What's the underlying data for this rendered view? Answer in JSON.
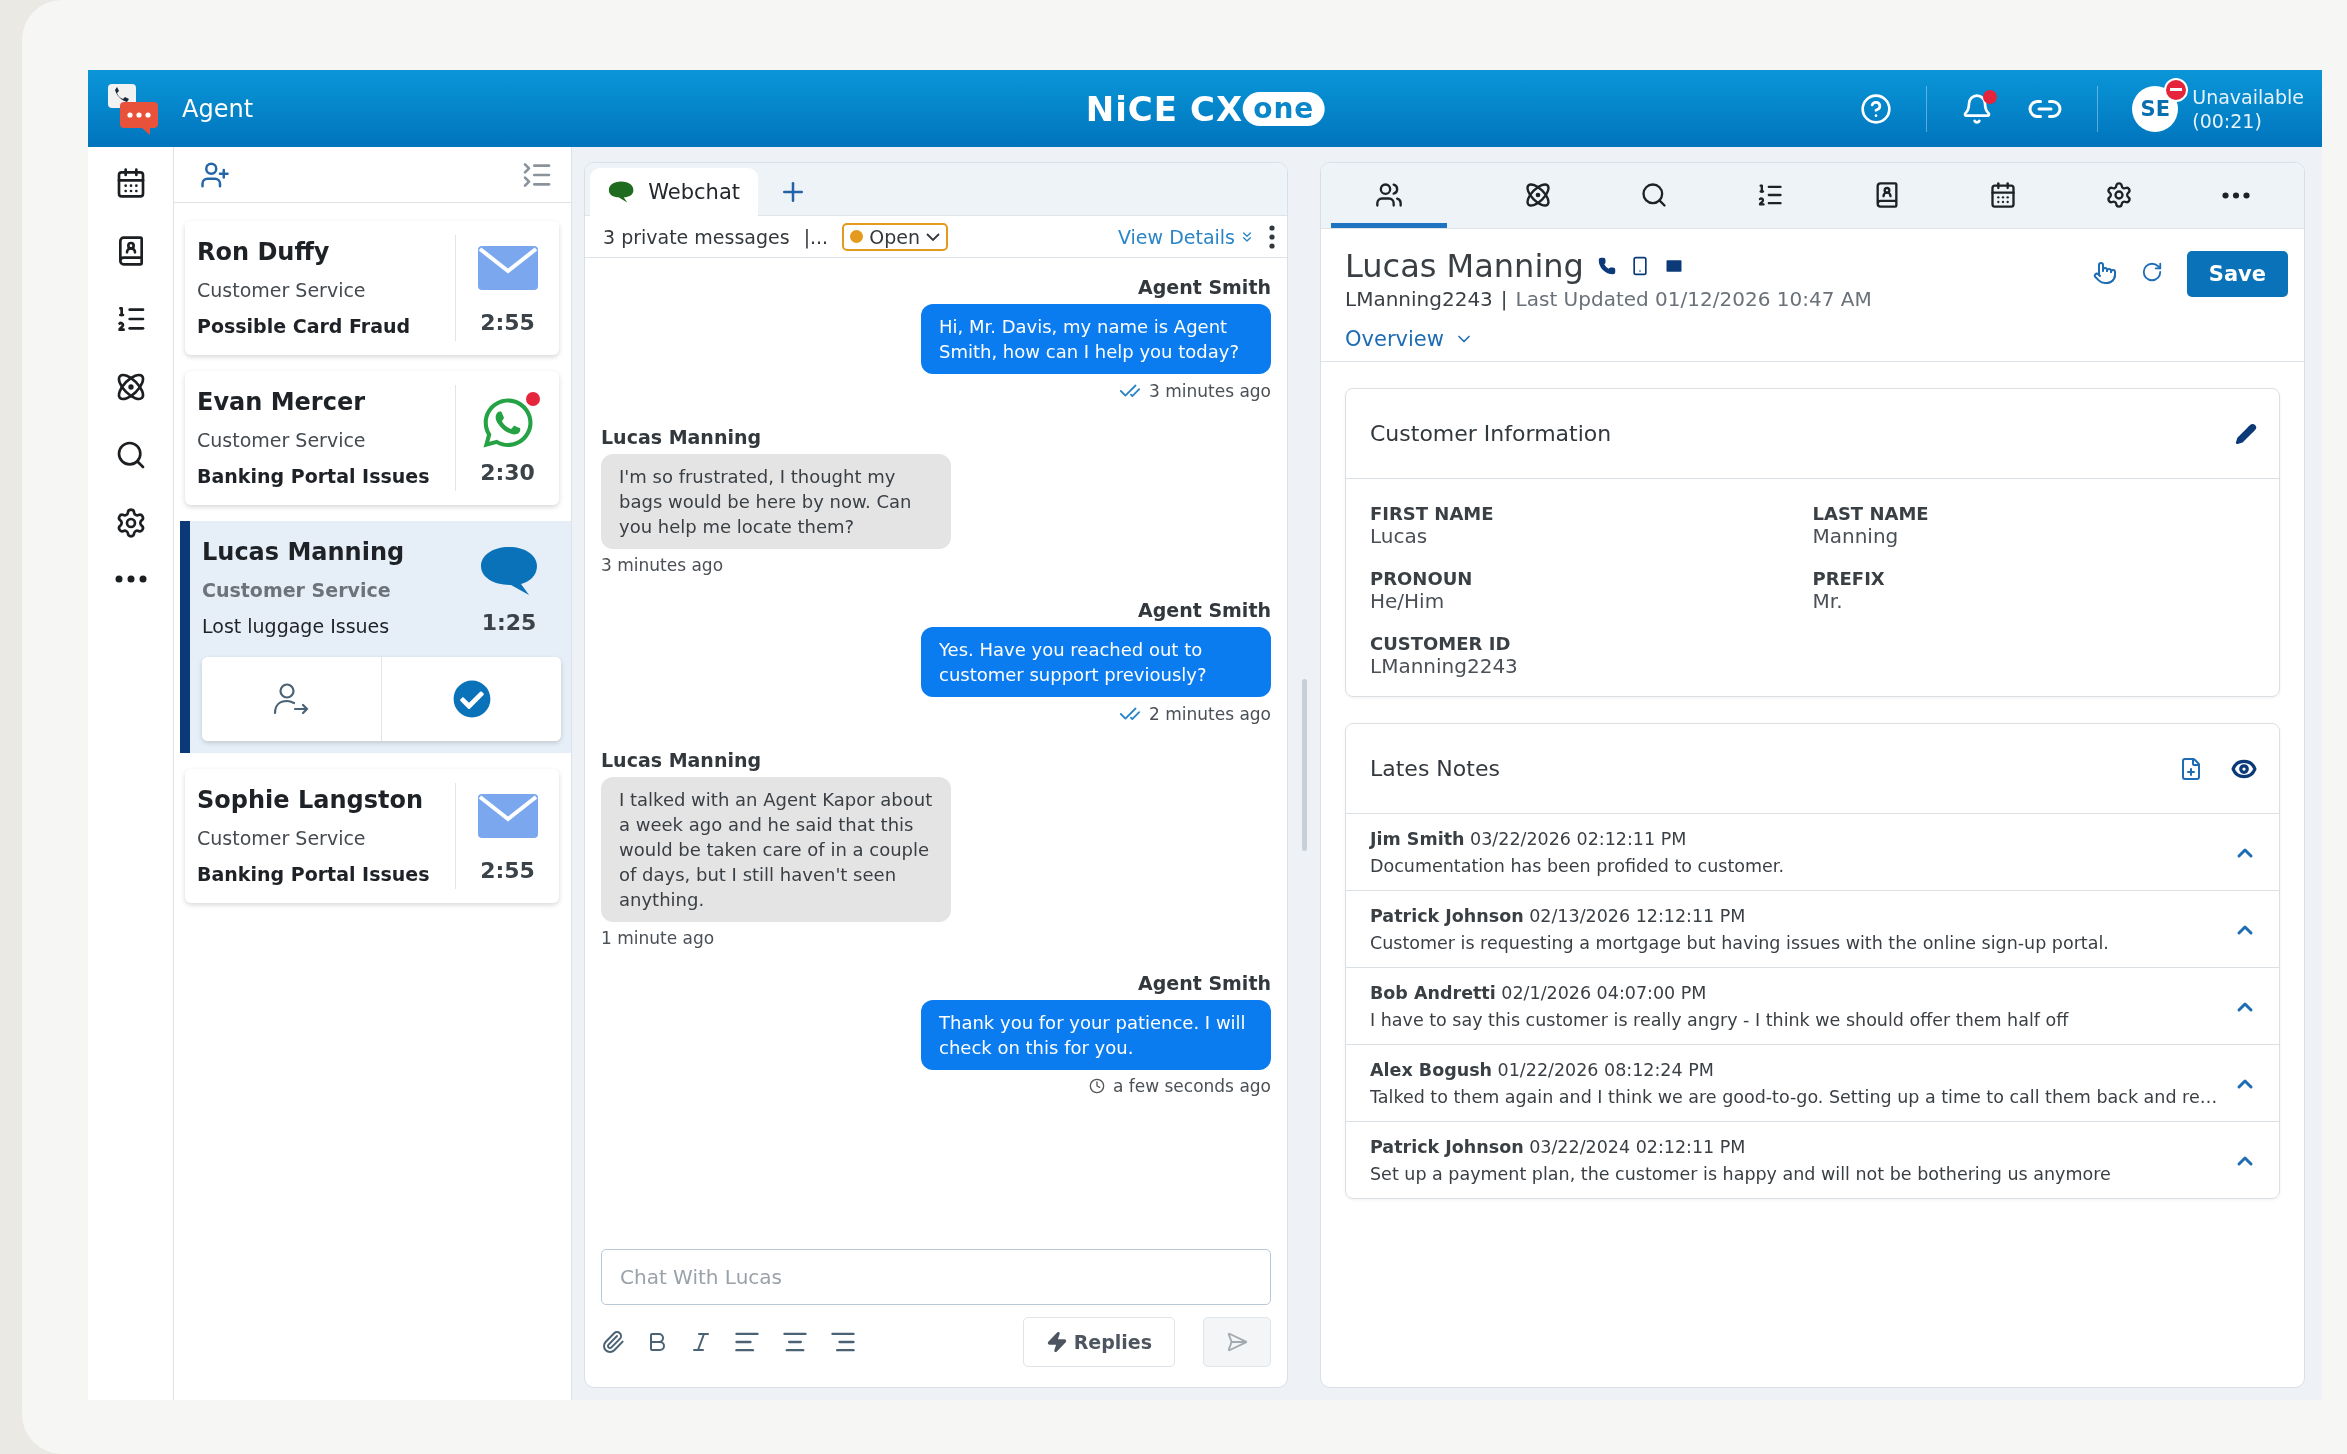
{
  "header": {
    "app_title": "Agent",
    "brand": {
      "name": "NiCE",
      "product": "CX",
      "suffix": "one"
    },
    "notifications_unread": true,
    "avatar": "SE",
    "status": "Unavailable",
    "status_timer": "(00:21)"
  },
  "rail": [
    {
      "kind": "calendar"
    },
    {
      "kind": "contacts"
    },
    {
      "kind": "queue"
    },
    {
      "kind": "ai"
    },
    {
      "kind": "search"
    },
    {
      "kind": "settings"
    },
    {
      "kind": "more"
    }
  ],
  "contacts": [
    {
      "name": "Ron Duffy",
      "queue": "Customer Service",
      "subject": "Possible Card Fraud",
      "time": "2:55",
      "kind": "email",
      "unread": false,
      "selected": false
    },
    {
      "name": "Evan Mercer",
      "queue": "Customer Service",
      "subject": "Banking Portal Issues",
      "time": "2:30",
      "kind": "whatsapp",
      "unread": true,
      "selected": false
    },
    {
      "name": "Lucas Manning",
      "queue": "Customer Service",
      "subject": "Lost luggage Issues",
      "time": "1:25",
      "kind": "chat",
      "unread": false,
      "selected": true
    },
    {
      "name": "Sophie Langston",
      "queue": "Customer Service",
      "subject": "Banking Portal Issues",
      "time": "2:55",
      "kind": "email",
      "unread": false,
      "selected": false
    }
  ],
  "chat": {
    "tab": "Webchat",
    "private_messages": "3 private messages",
    "separator": "|...",
    "status": "Open",
    "view_details": "View Details",
    "messages": [
      {
        "kind": "agent",
        "sender": "Agent Smith",
        "text": "Hi, Mr. Davis, my name is Agent Smith, how can I help you today?",
        "time": "3 minutes ago",
        "receipt": {
          "kind": "read"
        }
      },
      {
        "kind": "customer",
        "sender": "Lucas Manning",
        "text": "I'm so frustrated, I thought my bags would be here by now. Can you help me locate them?",
        "time": "3 minutes ago"
      },
      {
        "kind": "agent",
        "sender": "Agent Smith",
        "text": "Yes. Have you reached out to customer support previously?",
        "time": "2 minutes ago",
        "receipt": {
          "kind": "read"
        }
      },
      {
        "kind": "customer",
        "sender": "Lucas Manning",
        "text": "I talked with an Agent Kapor about a week ago and he said that this would be taken care of in a couple of days, but I still haven't seen anything.",
        "time": "1 minute ago"
      },
      {
        "kind": "agent",
        "sender": "Agent Smith",
        "text": "Thank you for your patience. I will check on this for you.",
        "time": "a few seconds ago",
        "receipt": {
          "kind": "pending"
        }
      }
    ],
    "placeholder": "Chat With Lucas",
    "replies": "Replies",
    "send_disabled": true
  },
  "profile": {
    "tabs": [
      {
        "kind": "contact",
        "selected": true
      },
      {
        "kind": "ai",
        "selected": false
      },
      {
        "kind": "search",
        "selected": false
      },
      {
        "kind": "queue",
        "selected": false
      },
      {
        "kind": "book",
        "selected": false
      },
      {
        "kind": "calendar",
        "selected": false
      },
      {
        "kind": "settings",
        "selected": false
      },
      {
        "kind": "more",
        "selected": false
      }
    ],
    "name": "Lucas Manning",
    "username": "LManning2243",
    "separator": "|",
    "updated": "Last Updated 01/12/2026 10:47 AM",
    "view": "Overview",
    "save": "Save",
    "info": {
      "title": "Customer Information",
      "fields": [
        {
          "label": "FIRST NAME",
          "value": "Lucas"
        },
        {
          "label": "LAST NAME",
          "value": "Manning"
        },
        {
          "label": "PRONOUN",
          "value": "He/Him"
        },
        {
          "label": "PREFIX",
          "value": "Mr."
        },
        {
          "label": "CUSTOMER ID",
          "value": "LManning2243"
        }
      ]
    },
    "notes": {
      "title": "Lates Notes",
      "items": [
        {
          "author": "Jim Smith",
          "date": "03/22/2026 02:12:11 PM",
          "text": "Documentation has been profided to customer."
        },
        {
          "author": "Patrick Johnson",
          "date": "02/13/2026 12:12:11 PM",
          "text": "Customer is requesting a mortgage but having issues with the online sign-up portal."
        },
        {
          "author": "Bob Andretti",
          "date": "02/1/2026 04:07:00 PM",
          "text": "I have to say this customer is really angry - I think we should offer them half off"
        },
        {
          "author": "Alex Bogush",
          "date": "01/22/2026 08:12:24 PM",
          "text": "Talked to them again and I think we are good-to-go. Setting up a time to call them back and re…"
        },
        {
          "author": "Patrick Johnson",
          "date": "03/22/2024 02:12:11 PM",
          "text": "Set up a payment plan, the customer is happy and will not be bothering us anymore"
        }
      ]
    }
  }
}
